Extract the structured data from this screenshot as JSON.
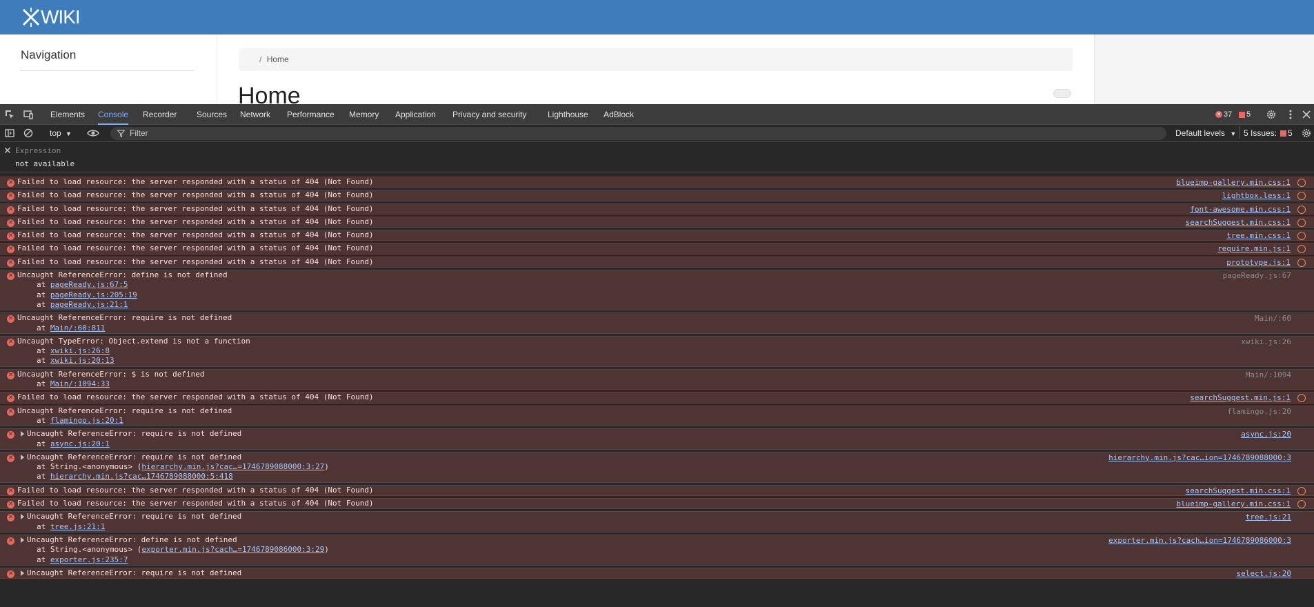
{
  "wiki": {
    "logo_text": "WIKI",
    "navigation_title": "Navigation",
    "breadcrumb_sep": "/",
    "breadcrumb_home": "Home",
    "page_title": "Home"
  },
  "devtools": {
    "tabs": [
      "Elements",
      "Console",
      "Recorder",
      "Sources",
      "Network",
      "Performance",
      "Memory",
      "Application",
      "Privacy and security",
      "Lighthouse",
      "AdBlock"
    ],
    "active_tab": "Console",
    "error_count": "37",
    "issue_count": "5",
    "context": "top",
    "filter_placeholder": "Filter",
    "default_levels": "Default levels",
    "issues_label": "5 Issues:",
    "issues_badge": "5",
    "expression_label": "Expression",
    "expression_value": "not available",
    "colors": {
      "accent": "#7cacf8",
      "error_bg": "#4e3534",
      "error_icon": "#e46962",
      "link": "#a8c7fa",
      "wiki_header": "#3e7cbc"
    }
  },
  "messages": [
    {
      "text": "Failed to load resource: the server responded with a status of 404 (Not Found)",
      "source": "blueimp-gallery.min.css:1",
      "link": true,
      "globe": true,
      "stack": []
    },
    {
      "text": "Failed to load resource: the server responded with a status of 404 (Not Found)",
      "source": "lightbox.less:1",
      "link": true,
      "globe": true,
      "stack": []
    },
    {
      "text": "Failed to load resource: the server responded with a status of 404 (Not Found)",
      "source": "font-awesome.min.css:1",
      "link": true,
      "globe": true,
      "stack": []
    },
    {
      "text": "Failed to load resource: the server responded with a status of 404 (Not Found)",
      "source": "searchSuggest.min.css:1",
      "link": true,
      "globe": true,
      "stack": []
    },
    {
      "text": "Failed to load resource: the server responded with a status of 404 (Not Found)",
      "source": "tree.min.css:1",
      "link": true,
      "globe": true,
      "stack": []
    },
    {
      "text": "Failed to load resource: the server responded with a status of 404 (Not Found)",
      "source": "require.min.js:1",
      "link": true,
      "globe": true,
      "stack": []
    },
    {
      "text": "Failed to load resource: the server responded with a status of 404 (Not Found)",
      "source": "prototype.js:1",
      "link": true,
      "globe": true,
      "stack": []
    },
    {
      "text": "Uncaught ReferenceError: define is not defined",
      "source": "pageReady.js:67",
      "link": false,
      "globe": false,
      "stack": [
        {
          "pre": "at ",
          "link": "pageReady.js:67:5"
        },
        {
          "pre": "at ",
          "link": "pageReady.js:205:19"
        },
        {
          "pre": "at ",
          "link": "pageReady.js:21:1"
        }
      ]
    },
    {
      "text": "Uncaught ReferenceError: require is not defined",
      "source": "Main/:60",
      "link": false,
      "globe": false,
      "stack": [
        {
          "pre": "at ",
          "link": "Main/:60:811"
        }
      ]
    },
    {
      "text": "Uncaught TypeError: Object.extend is not a function",
      "source": "xwiki.js:26",
      "link": false,
      "globe": false,
      "stack": [
        {
          "pre": "at ",
          "link": "xwiki.js:26:8"
        },
        {
          "pre": "at ",
          "link": "xwiki.js:20:13"
        }
      ]
    },
    {
      "text": "Uncaught ReferenceError: $ is not defined",
      "source": "Main/:1094",
      "link": false,
      "globe": false,
      "stack": [
        {
          "pre": "at ",
          "link": "Main/:1094:33"
        }
      ]
    },
    {
      "text": "Failed to load resource: the server responded with a status of 404 (Not Found)",
      "source": "searchSuggest.min.js:1",
      "link": true,
      "globe": true,
      "stack": []
    },
    {
      "text": "Uncaught ReferenceError: require is not defined",
      "source": "flamingo.js:20",
      "link": false,
      "globe": false,
      "stack": [
        {
          "pre": "at ",
          "link": "flamingo.js:20:1"
        }
      ]
    },
    {
      "text": "Uncaught ReferenceError: require is not defined",
      "source": "async.js:20",
      "link": true,
      "globe": false,
      "expandable": true,
      "stack": [
        {
          "pre": "at ",
          "link": "async.js:20:1"
        }
      ]
    },
    {
      "text": "Uncaught ReferenceError: require is not defined",
      "source": "hierarchy.min.js?cac…ion=1746789088000:3",
      "link": true,
      "globe": false,
      "expandable": true,
      "stack": [
        {
          "pre": "at String.<anonymous> (",
          "link": "hierarchy.min.js?cac…=1746789088000:3:27",
          "post": ")"
        },
        {
          "pre": "at ",
          "link": "hierarchy.min.js?cac…1746789088000:5:418"
        }
      ]
    },
    {
      "text": "Failed to load resource: the server responded with a status of 404 (Not Found)",
      "source": "searchSuggest.min.css:1",
      "link": true,
      "globe": true,
      "stack": []
    },
    {
      "text": "Failed to load resource: the server responded with a status of 404 (Not Found)",
      "source": "blueimp-gallery.min.css:1",
      "link": true,
      "globe": true,
      "stack": []
    },
    {
      "text": "Uncaught ReferenceError: require is not defined",
      "source": "tree.js:21",
      "link": true,
      "globe": false,
      "expandable": true,
      "stack": [
        {
          "pre": "at ",
          "link": "tree.js:21:1"
        }
      ]
    },
    {
      "text": "Uncaught ReferenceError: define is not defined",
      "source": "exporter.min.js?cach…ion=1746789086000:3",
      "link": true,
      "globe": false,
      "expandable": true,
      "stack": [
        {
          "pre": "at String.<anonymous> (",
          "link": "exporter.min.js?cach…=1746789086000:3:29",
          "post": ")"
        },
        {
          "pre": "at ",
          "link": "exporter.js:235:7"
        }
      ]
    },
    {
      "text": "Uncaught ReferenceError: require is not defined",
      "source": "select.js:20",
      "link": true,
      "globe": false,
      "expandable": true,
      "stack": []
    }
  ]
}
